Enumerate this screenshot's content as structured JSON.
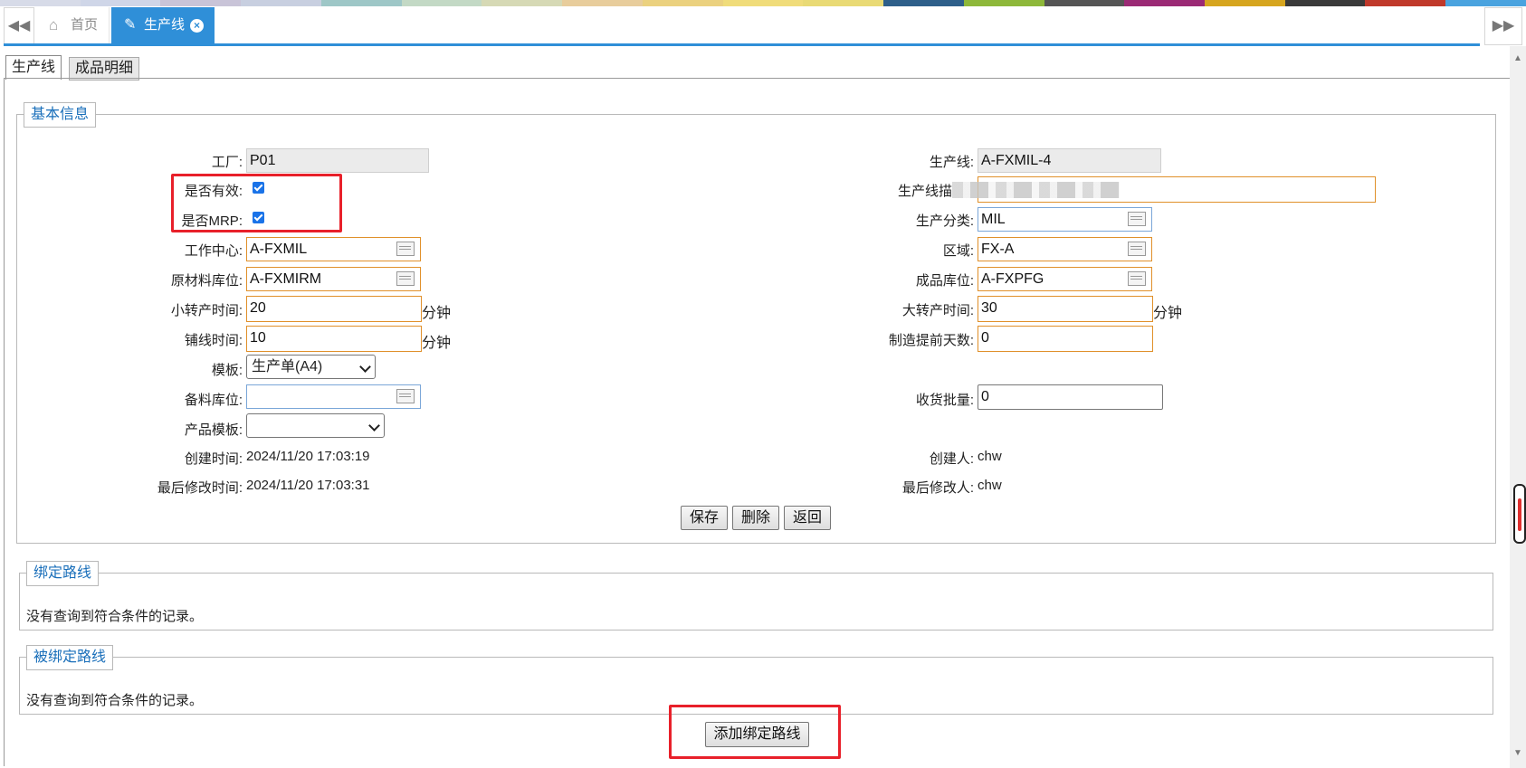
{
  "header": {
    "colors": [
      "#d7dbe8",
      "#cfd6e8",
      "#c9c4d8",
      "#c8cfe0",
      "#9ec7c7",
      "#c3d9c5",
      "#d6d9b5",
      "#e8cd9c",
      "#ebd17f",
      "#f0dc7a",
      "#e9da75",
      "#2e5f8a",
      "#8eb83a",
      "#555555",
      "#9b2a75",
      "#d6a51f",
      "#3a3a3a",
      "#c0392b",
      "#4aa3df"
    ],
    "nav_prev_icon": "double-left-arrow",
    "nav_next_icon": "double-right-arrow",
    "tabs": [
      {
        "label": "首页",
        "icon": "home-icon"
      },
      {
        "label": "生产线",
        "icon": "edit-icon",
        "close_icon": "close-circle-icon"
      }
    ]
  },
  "subtabs": [
    {
      "label": "生产线",
      "active": true
    },
    {
      "label": "成品明细",
      "active": false
    }
  ],
  "basic": {
    "legend": "基本信息",
    "factory": {
      "label": "工厂:",
      "value": "P01"
    },
    "line": {
      "label": "生产线:",
      "value": "A-FXMIL-4"
    },
    "valid": {
      "label": "是否有效:",
      "checked": true
    },
    "line_desc": {
      "label": "生产线描",
      "value": ""
    },
    "mrp": {
      "label": "是否MRP:",
      "checked": true
    },
    "category": {
      "label": "生产分类:",
      "value": "MIL"
    },
    "workcenter": {
      "label": "工作中心:",
      "value": "A-FXMIL"
    },
    "area": {
      "label": "区域:",
      "value": "FX-A"
    },
    "raw_loc": {
      "label": "原材料库位:",
      "value": "A-FXMIRM"
    },
    "fg_loc": {
      "label": "成品库位:",
      "value": "A-FXPFG"
    },
    "small_change": {
      "label": "小转产时间:",
      "value": "20",
      "unit": "分钟"
    },
    "big_change": {
      "label": "大转产时间:",
      "value": "30",
      "unit": "分钟"
    },
    "line_time": {
      "label": "铺线时间:",
      "value": "10",
      "unit": "分钟"
    },
    "lead_days": {
      "label": "制造提前天数:",
      "value": "0"
    },
    "template": {
      "label": "模板:",
      "value": "生产单(A4)"
    },
    "spare_loc": {
      "label": "备料库位:",
      "value": ""
    },
    "receive_batch": {
      "label": "收货批量:",
      "value": "0"
    },
    "product_template": {
      "label": "产品模板:",
      "value": ""
    },
    "created_time": {
      "label": "创建时间:",
      "value": "2024/11/20 17:03:19"
    },
    "creator": {
      "label": "创建人:",
      "value": "chw"
    },
    "modified_time": {
      "label": "最后修改时间:",
      "value": "2024/11/20 17:03:31"
    },
    "modifier": {
      "label": "最后修改人:",
      "value": "chw"
    },
    "buttons": {
      "save": "保存",
      "delete": "删除",
      "back": "返回"
    }
  },
  "bound_routes": {
    "legend": "绑定路线",
    "empty": "没有查询到符合条件的记录。"
  },
  "bound_by_routes": {
    "legend": "被绑定路线",
    "empty": "没有查询到符合条件的记录。"
  },
  "add_button": "添加绑定路线"
}
